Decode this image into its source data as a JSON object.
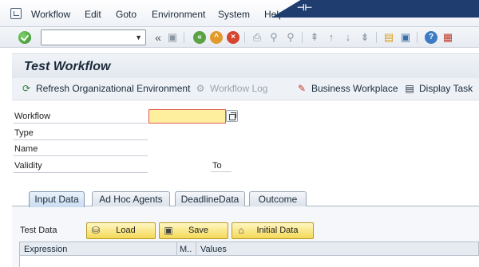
{
  "menu": {
    "items": [
      "Workflow",
      "Edit",
      "Goto",
      "Environment",
      "System",
      "Help"
    ]
  },
  "toolbar": {
    "command_field_value": "",
    "icons": [
      "ok-icon",
      "command-field",
      "back-icon",
      "exit-icon",
      "cancel-icon",
      "save-icon",
      "print-icon",
      "find-icon",
      "find-next-icon",
      "first-page-icon",
      "previous-page-icon",
      "next-page-icon",
      "last-page-icon",
      "create-session-icon",
      "shortcut-icon",
      "help-icon",
      "customize-layout-icon"
    ]
  },
  "title": "Test Workflow",
  "app_toolbar": {
    "refresh_label": "Refresh Organizational Environment",
    "workflow_log_label": "Workflow Log",
    "business_workplace_label": "Business Workplace",
    "display_task_label": "Display Task"
  },
  "form": {
    "workflow_label": "Workflow",
    "workflow_value": "",
    "type_label": "Type",
    "name_label": "Name",
    "validity_label": "Validity",
    "to_label": "To"
  },
  "tabs": [
    {
      "label": "Input Data",
      "active": true
    },
    {
      "label": "Ad Hoc Agents",
      "active": false
    },
    {
      "label": "DeadlineData",
      "active": false
    },
    {
      "label": "Outcome",
      "active": false
    }
  ],
  "input_data": {
    "label": "Test Data",
    "load_label": "Load",
    "save_label": "Save",
    "initial_label": "Initial Data"
  },
  "table": {
    "columns": [
      "Expression",
      "M..",
      "Values"
    ]
  },
  "colors": {
    "banner": "#1f3d6e",
    "required_field": "#fdef9d",
    "button_yellow": "#f4d857"
  }
}
